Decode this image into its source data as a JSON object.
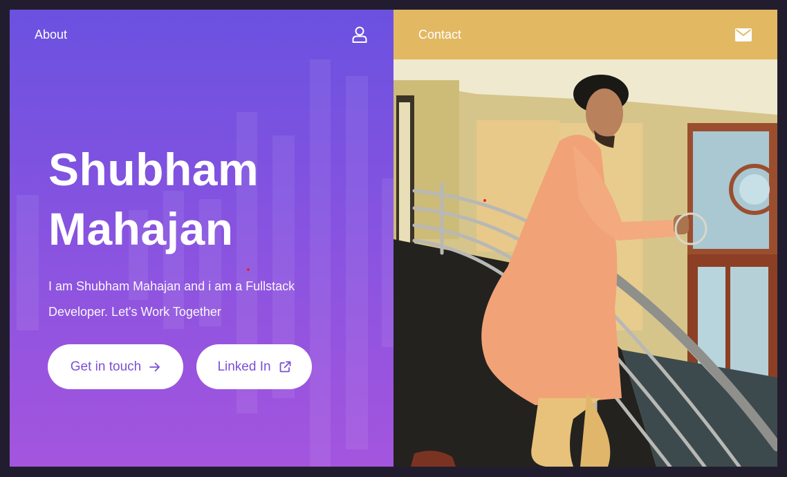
{
  "nav_left": {
    "about_label": "About",
    "user_icon": "user-icon"
  },
  "nav_right": {
    "contact_label": "Contact",
    "mail_icon": "envelope-icon"
  },
  "hero": {
    "name_line1": "Shubham",
    "name_line2": "Mahajan",
    "intro": "I am Shubham Mahajan and i am a Fullstack Developer. Let's Work Together"
  },
  "buttons": {
    "get_in_touch": "Get in touch",
    "get_in_touch_icon": "arrow-right-icon",
    "linkedin": "Linked In",
    "linkedin_icon": "external-link-icon"
  },
  "colors": {
    "left_gradient_top": "#6b51e0",
    "left_gradient_bottom": "#a455de",
    "contact_bar": "#e2b862",
    "button_text": "#7a4fd6",
    "background": "#221d2e"
  },
  "photo": {
    "subject": "profile-photo"
  }
}
